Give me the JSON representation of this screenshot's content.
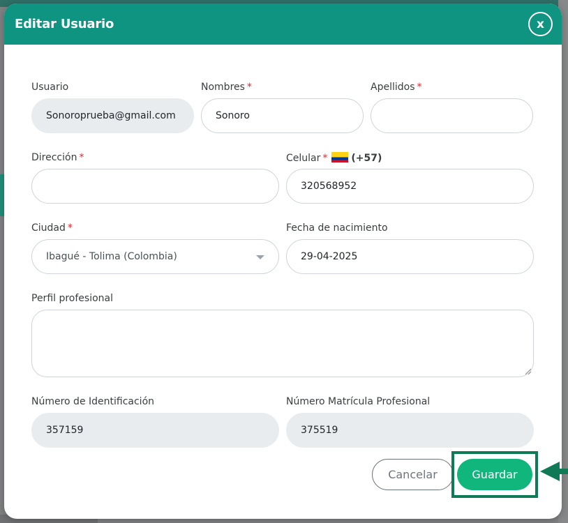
{
  "modal": {
    "title": "Editar Usuario",
    "close_label": "x"
  },
  "form": {
    "usuario": {
      "label": "Usuario",
      "value": "Sonoroprueba@gmail.com",
      "required": false
    },
    "nombres": {
      "label": "Nombres",
      "value": "Sonoro",
      "required_mark": "*"
    },
    "apellidos": {
      "label": "Apellidos",
      "value": "",
      "required_mark": "*"
    },
    "direccion": {
      "label": "Dirección",
      "value": "",
      "required_mark": "*"
    },
    "celular": {
      "label": "Celular",
      "required_mark": "*",
      "country_code": "(+57)",
      "value": "320568952",
      "flag_icon": "colombia-flag-icon"
    },
    "ciudad": {
      "label": "Ciudad",
      "required_mark": "*",
      "value": "Ibagué - Tolima (Colombia)"
    },
    "fecha_nacimiento": {
      "label": "Fecha de nacimiento",
      "value": "29-04-2025"
    },
    "perfil_profesional": {
      "label": "Perfil profesional",
      "value": ""
    },
    "numero_identificacion": {
      "label": "Número de Identificación",
      "value": "357159"
    },
    "numero_matricula": {
      "label": "Número Matrícula Profesional",
      "value": "375519"
    }
  },
  "actions": {
    "cancel_label": "Cancelar",
    "save_label": "Guardar"
  },
  "colors": {
    "header": "#0e9481",
    "save_button": "#11b67d",
    "highlight": "#0f7a55",
    "required": "#e0262f"
  }
}
